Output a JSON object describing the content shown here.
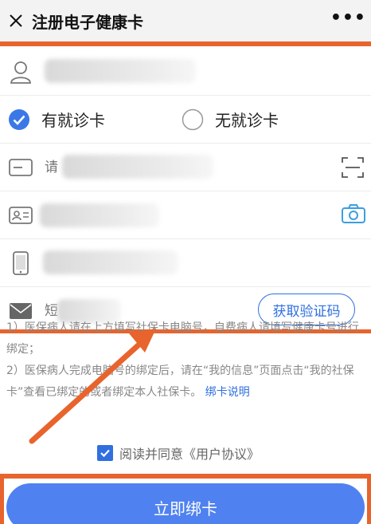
{
  "header": {
    "title": "注册电子健康卡",
    "more": "•••"
  },
  "form": {
    "radio_has": "有就诊卡",
    "radio_none": "无就诊卡",
    "card_placeholder": "请",
    "code_placeholder": "短",
    "get_code": "获取验证码"
  },
  "notes": {
    "line1": "1）医保病人请在上方填写社保卡电脑号，自费病人请填写健康卡号进行绑定；",
    "line2": "2）医保病人完成电脑号的绑定后，请在“我的信息”页面点击“我的社保卡”查看已绑定的或者绑定本人社保卡。",
    "link": "绑卡说明"
  },
  "agree": {
    "text": "阅读并同意",
    "link": "《用户协议》"
  },
  "bind_button": "立即绑卡",
  "colors": {
    "accent": "#2f6fe0",
    "highlight": "#e8642c",
    "button": "#4f82f0"
  }
}
